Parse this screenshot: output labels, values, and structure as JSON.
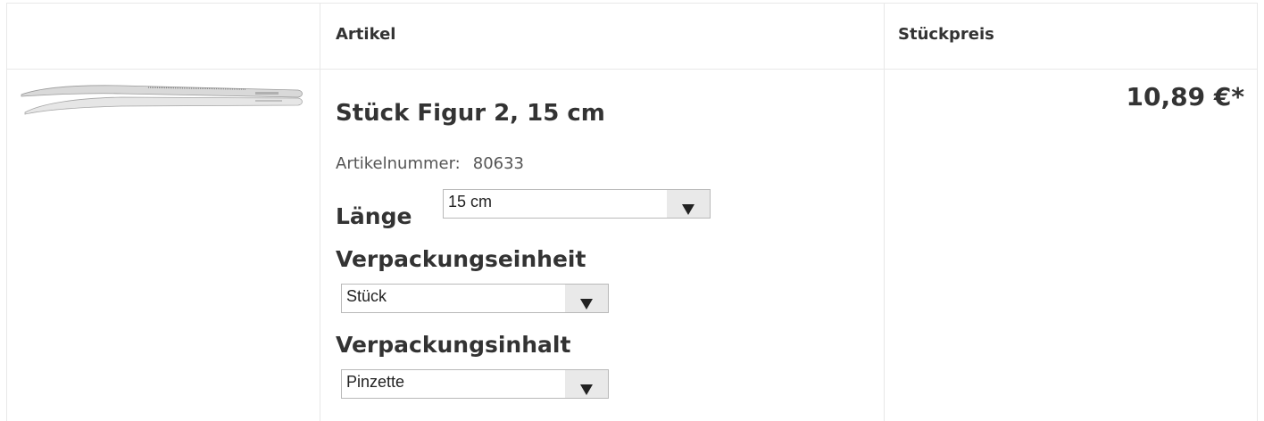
{
  "table": {
    "header_article": "Artikel",
    "header_unit_price": "Stückpreis"
  },
  "product": {
    "image_icon": "tweezers-image",
    "title": "Stück Figur 2, 15 cm",
    "article_number_label": "Artikelnummer:",
    "article_number": "80633",
    "price": "10,89 €*",
    "options": {
      "length": {
        "label": "Länge",
        "value": "15 cm"
      },
      "packaging_unit": {
        "label": "Verpackungseinheit",
        "value": "Stück"
      },
      "packaging_content": {
        "label": "Verpackungsinhalt",
        "value": "Pinzette"
      }
    }
  },
  "colors": {
    "border": "#e8e8e8",
    "text": "#333333",
    "select_arrow_bg": "#e9e9e9"
  }
}
